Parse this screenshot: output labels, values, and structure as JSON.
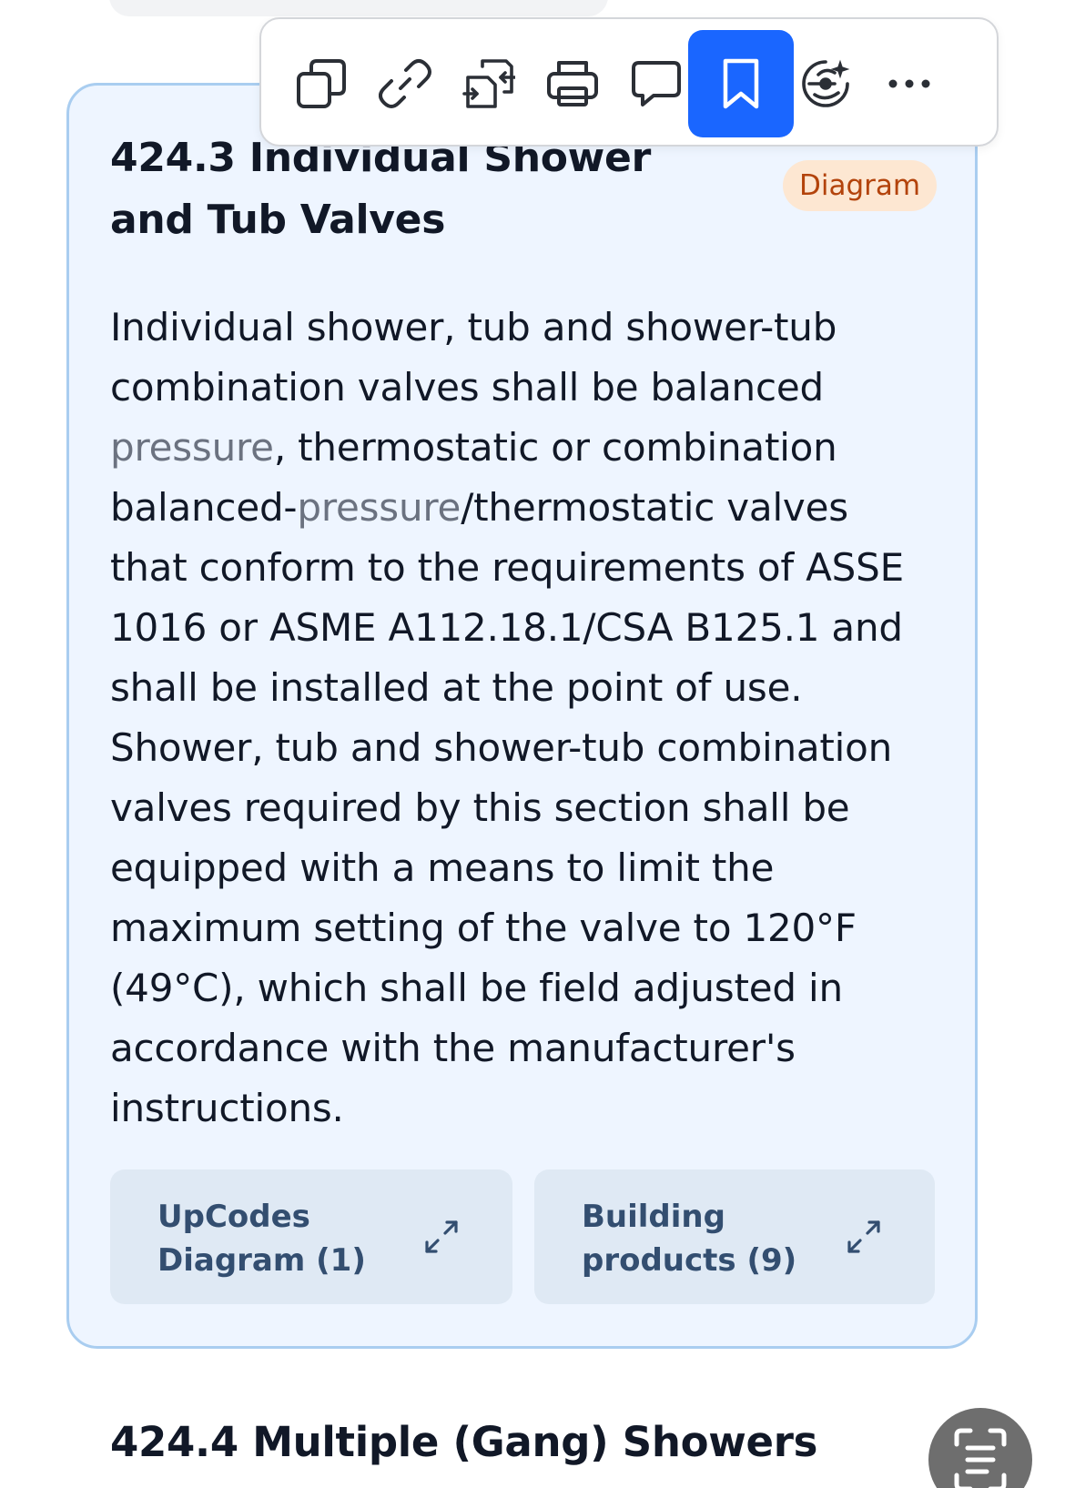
{
  "toolbar": {
    "items": [
      {
        "icon": "copy-icon"
      },
      {
        "icon": "link-icon"
      },
      {
        "icon": "compare-icon"
      },
      {
        "icon": "print-icon"
      },
      {
        "icon": "comment-icon"
      },
      {
        "icon": "bookmark-icon",
        "active": true
      },
      {
        "icon": "ai-assistant-icon"
      },
      {
        "icon": "more-icon"
      }
    ],
    "active_color": "#1a66ff"
  },
  "section": {
    "title": "424.3 Individual Shower and Tub Valves",
    "badge": "Diagram",
    "body": {
      "part1": "Individual shower, tub and shower-tub combination valves shall be balanced ",
      "term1": "pressure",
      "part2": ", thermostatic or combination balanced-",
      "term2": "pressure",
      "part3": "/thermostatic valves that conform to the requirements of ASSE 1016 or ASME A112.18.1/CSA B125.1 and shall be installed at the point of use. Shower, tub and shower-tub combination valves required by this section shall be equipped with a means to limit the maximum setting of the valve to 120°F (49°C), which shall be field adjusted in accordance with the manufacturer's instructions."
    },
    "resources": [
      {
        "label": "UpCodes Diagram (1)",
        "icon": "expand-icon"
      },
      {
        "label": "Building products (9)",
        "icon": "expand-icon"
      }
    ]
  },
  "next_section": {
    "title": "424.4 Multiple (Gang) Showers"
  },
  "fab": {
    "icon": "scan-text-icon"
  },
  "colors": {
    "card_background": "#eef5ff",
    "card_border": "#a9cdf0",
    "badge_background": "#fde7d2",
    "badge_text": "#b3430b",
    "term_link": "#6b7280"
  }
}
